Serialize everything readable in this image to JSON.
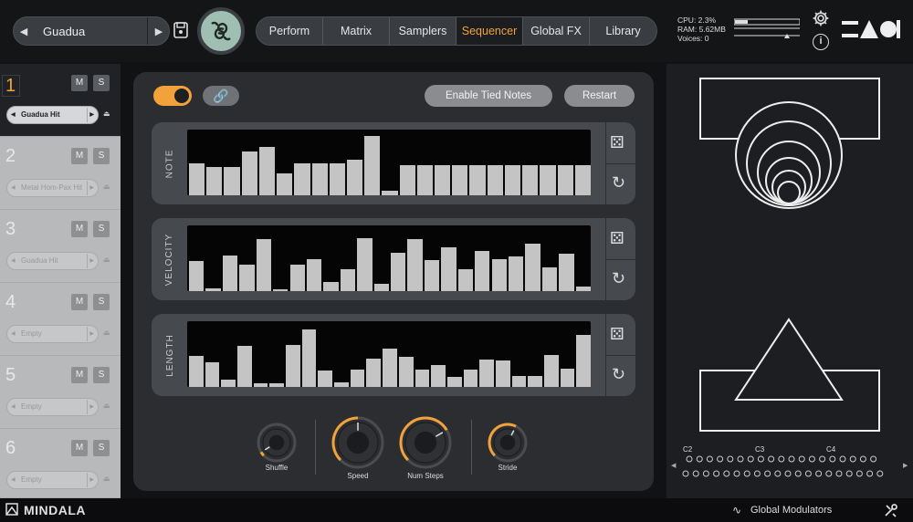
{
  "header": {
    "preset_name": "Guadua",
    "tabs": [
      "Perform",
      "Matrix",
      "Samplers",
      "Sequencer",
      "Global FX",
      "Library"
    ],
    "active_tab": "Sequencer",
    "cpu": "CPU: 2.3%",
    "ram": "RAM: 5.62MB",
    "voices": "Voices: 0"
  },
  "samplers": [
    {
      "num": "1",
      "m": "M",
      "s": "S",
      "sample": "Guadua Hit",
      "active": true
    },
    {
      "num": "2",
      "m": "M",
      "s": "S",
      "sample": "Metal Hom-Pax Hit",
      "active": false
    },
    {
      "num": "3",
      "m": "M",
      "s": "S",
      "sample": "Guadua Hit",
      "active": false
    },
    {
      "num": "4",
      "m": "M",
      "s": "S",
      "sample": "Empty",
      "active": false
    },
    {
      "num": "5",
      "m": "M",
      "s": "S",
      "sample": "Empty",
      "active": false
    },
    {
      "num": "6",
      "m": "M",
      "s": "S",
      "sample": "Empty",
      "active": false
    }
  ],
  "sequencer": {
    "enable_tied_notes": "Enable Tied Notes",
    "restart": "Restart",
    "rows": [
      {
        "label": "NOTE",
        "values": [
          0.52,
          0.46,
          0.46,
          0.7,
          0.78,
          0.35,
          0.52,
          0.52,
          0.52,
          0.58,
          0.95,
          0.08,
          0.48,
          0.48,
          0.48,
          0.48,
          0.48,
          0.48,
          0.48,
          0.48,
          0.48,
          0.48,
          0.48
        ]
      },
      {
        "label": "VELOCITY",
        "values": [
          0.48,
          0.05,
          0.58,
          0.42,
          0.84,
          0.02,
          0.42,
          0.52,
          0.14,
          0.35,
          0.86,
          0.12,
          0.62,
          0.84,
          0.5,
          0.7,
          0.36,
          0.64,
          0.52,
          0.56,
          0.76,
          0.38,
          0.6,
          0.08
        ]
      },
      {
        "label": "LENGTH",
        "values": [
          0.5,
          0.4,
          0.12,
          0.66,
          0.06,
          0.06,
          0.68,
          0.92,
          0.26,
          0.08,
          0.28,
          0.46,
          0.62,
          0.48,
          0.28,
          0.36,
          0.16,
          0.28,
          0.44,
          0.42,
          0.18,
          0.18,
          0.52,
          0.3,
          0.84
        ]
      }
    ],
    "knobs": [
      {
        "label": "Shuffle",
        "value": 0.05
      },
      {
        "label": "Speed",
        "value": 0.5
      },
      {
        "label": "Num Steps",
        "value": 0.72
      },
      {
        "label": "Stride",
        "value": 0.6
      }
    ]
  },
  "keyboard": {
    "octaves": [
      "C2",
      "C3",
      "C4"
    ]
  },
  "footer": {
    "brand": "MINDALA",
    "global_modulators": "Global Modulators"
  }
}
